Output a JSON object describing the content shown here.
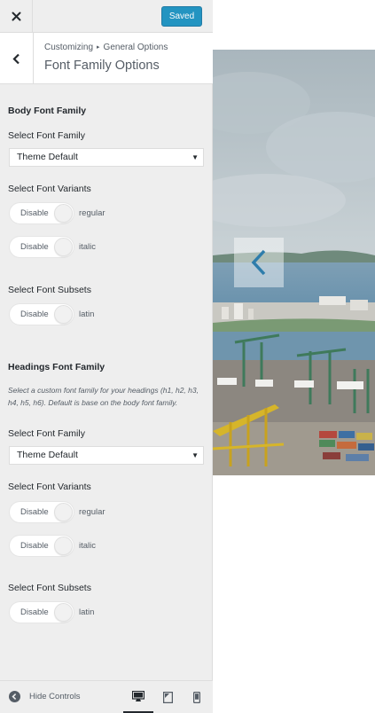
{
  "header": {
    "close_icon": "close-icon",
    "saved_label": "Saved"
  },
  "section": {
    "breadcrumb_root": "Customizing",
    "breadcrumb_separator": "▸",
    "breadcrumb_current": "General Options",
    "title": "Font Family Options"
  },
  "body_font": {
    "heading": "Body Font Family",
    "select_label": "Select Font Family",
    "select_value": "Theme Default",
    "variants_label": "Select Font Variants",
    "variants": [
      {
        "toggle_text": "Disable",
        "name": "regular"
      },
      {
        "toggle_text": "Disable",
        "name": "italic"
      }
    ],
    "subsets_label": "Select Font Subsets",
    "subsets": [
      {
        "toggle_text": "Disable",
        "name": "latin"
      }
    ]
  },
  "headings_font": {
    "heading": "Headings Font Family",
    "description": "Select a custom font family for your headings (h1, h2, h3, h4, h5, h6). Default is base on the body font family.",
    "select_label": "Select Font Family",
    "select_value": "Theme Default",
    "variants_label": "Select Font Variants",
    "variants": [
      {
        "toggle_text": "Disable",
        "name": "regular"
      },
      {
        "toggle_text": "Disable",
        "name": "italic"
      }
    ],
    "subsets_label": "Select Font Subsets",
    "subsets": [
      {
        "toggle_text": "Disable",
        "name": "latin"
      }
    ]
  },
  "footer": {
    "hide_controls_label": "Hide Controls",
    "devices": [
      "desktop",
      "tablet",
      "mobile"
    ],
    "active_device": "desktop"
  },
  "preview": {
    "slider_prev_icon": "chevron-left-icon"
  },
  "colors": {
    "accent": "#0085ba",
    "panel_bg": "#eeeeee",
    "text": "#23282d",
    "muted": "#555d66",
    "chevron": "#2e7dab"
  }
}
